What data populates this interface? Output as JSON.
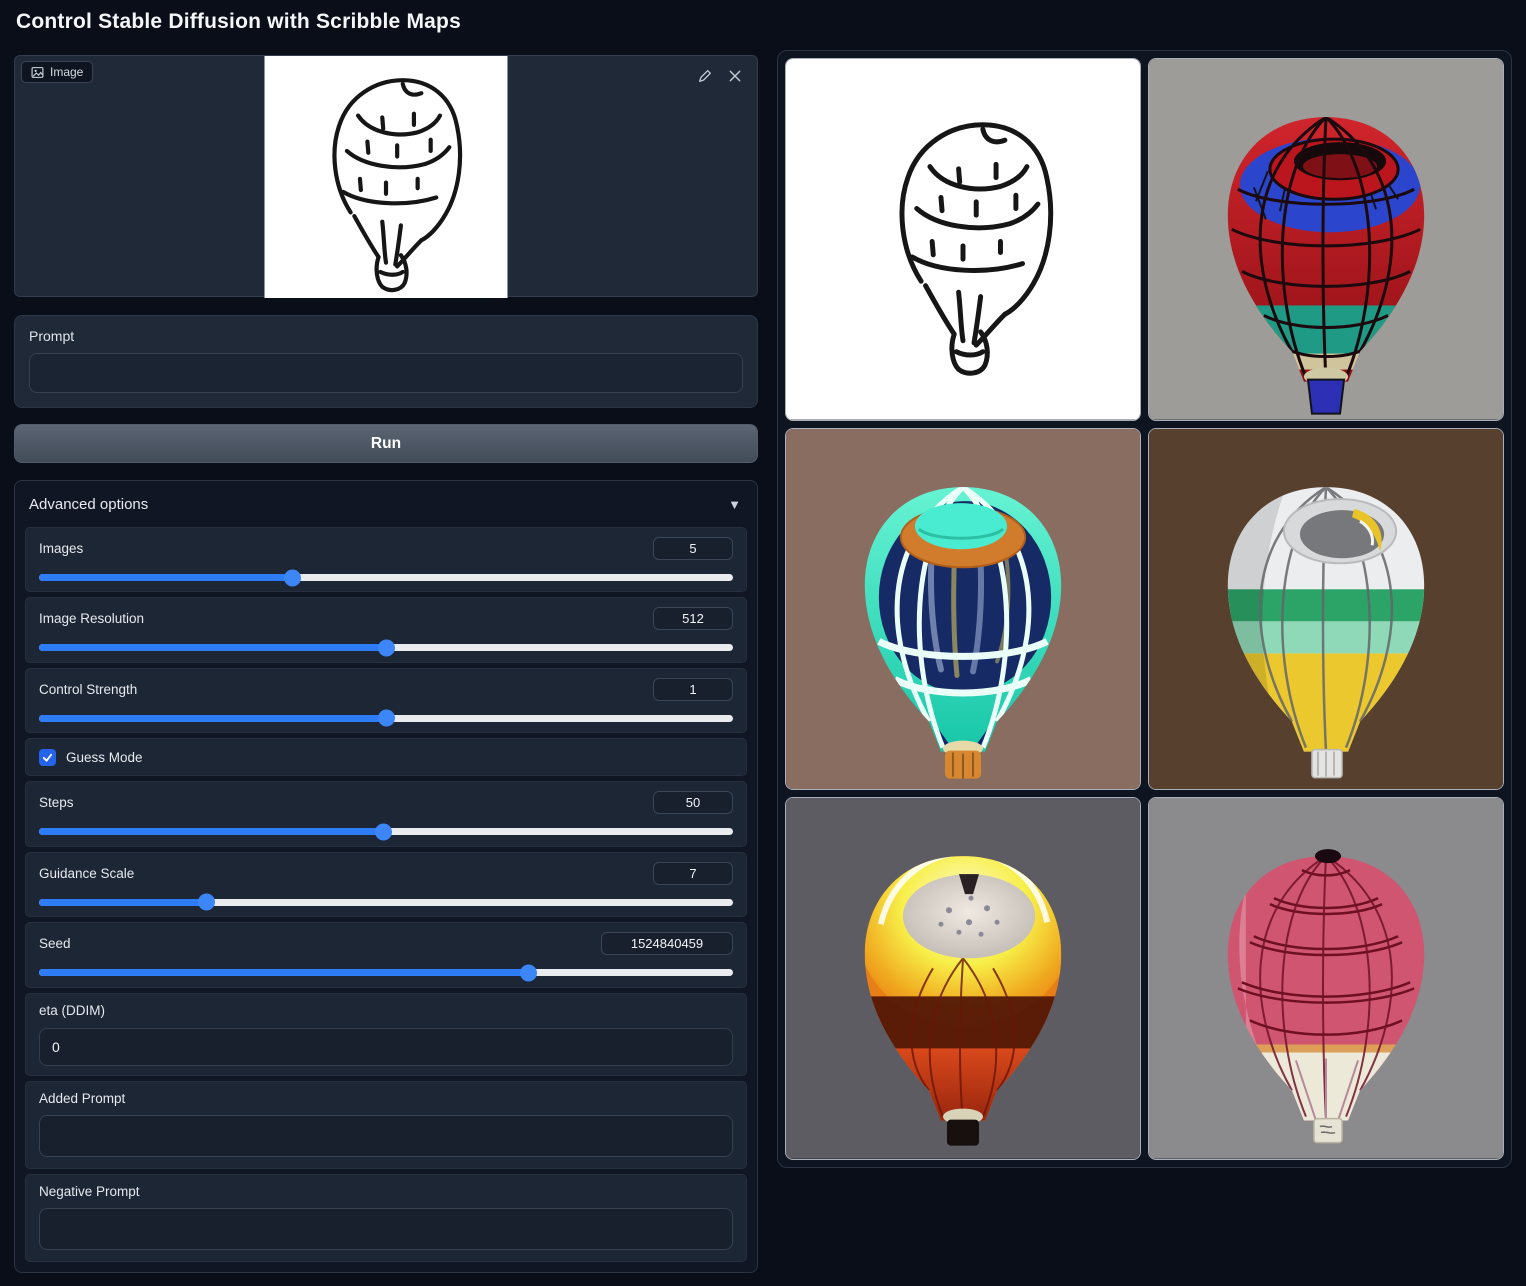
{
  "title": "Control Stable Diffusion with Scribble Maps",
  "colors": {
    "page": "#0a0e18",
    "panel": "#1f2937",
    "accent": "#2e7df6",
    "handle": "#3d86f8",
    "track": "#e9ebee",
    "checkbox": "#2563eb"
  },
  "image_input": {
    "label": "Image"
  },
  "prompt": {
    "label": "Prompt",
    "value": ""
  },
  "run_button": {
    "label": "Run"
  },
  "advanced": {
    "label": "Advanced options",
    "caret": "▼",
    "sliders": [
      {
        "label": "Images",
        "value": "5",
        "percent": 36.5
      },
      {
        "label": "Image Resolution",
        "value": "512",
        "percent": 50
      },
      {
        "label": "Control Strength",
        "value": "1",
        "percent": 50
      },
      {
        "label": "Steps",
        "value": "50",
        "percent": 49.5
      },
      {
        "label": "Guidance Scale",
        "value": "7",
        "percent": 24
      },
      {
        "label": "Seed",
        "value": "1524840459",
        "percent": 70.5
      }
    ],
    "checkbox": {
      "label": "Guess Mode",
      "checked": true
    },
    "eta": {
      "label": "eta (DDIM)",
      "value": "0"
    },
    "added_prompt": {
      "label": "Added Prompt",
      "value": ""
    },
    "negative_prompt": {
      "label": "Negative Prompt",
      "value": ""
    }
  },
  "gallery": {
    "items": [
      {
        "name": "scribble drawing of a hot air balloon",
        "bg": "#ffffff",
        "stroke": "#161616"
      },
      {
        "name": "red wireframe balloon render",
        "bg": "#9d9c98",
        "body": "#c81d24",
        "band": "#1e9a85",
        "ring": "#2b46cc",
        "basket": "#2d2fb5"
      },
      {
        "name": "teal balloon render",
        "bg": "#8a6d61",
        "body": "#2fdfbd",
        "interior": "#162a66",
        "rim": "#d07c2c",
        "basket": "#d6872f"
      },
      {
        "name": "white green yellow balloon render",
        "bg": "#58402f",
        "body": "#ecedee",
        "band": "#2da467",
        "lower": "#eac82e",
        "basket": "#e3e3e1"
      },
      {
        "name": "orange glowing balloon render",
        "bg": "#5d5c62",
        "glow": "#f7ef48",
        "body": "#e87f16",
        "band": "#4e1407",
        "lower": "#c43a16",
        "basket": "#17100f"
      },
      {
        "name": "pink balloon render",
        "bg": "#8b8b8e",
        "body": "#d05570",
        "lower": "#ece9d8",
        "lines": "#6e0f22",
        "basket": "#e6e3d4"
      }
    ]
  }
}
